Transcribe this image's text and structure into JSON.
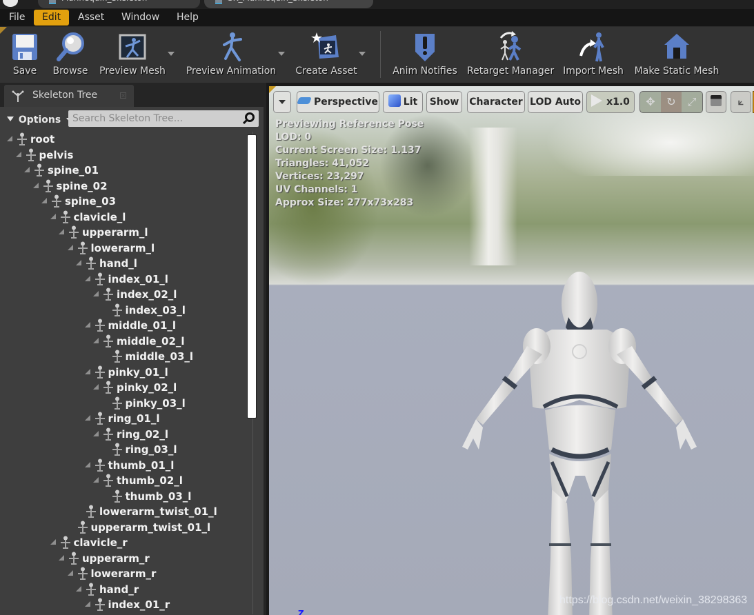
{
  "window": {
    "doc_tabs": [
      {
        "label": "Mannequin_Skeleton",
        "icon": "skeleton-asset-icon"
      },
      {
        "label": "SK_Mannequin_Skeleton",
        "icon": "skeleton-asset-icon"
      }
    ]
  },
  "menu": {
    "items": [
      {
        "label": "File",
        "active": false
      },
      {
        "label": "Edit",
        "active": true
      },
      {
        "label": "Asset",
        "active": false
      },
      {
        "label": "Window",
        "active": false
      },
      {
        "label": "Help",
        "active": false
      }
    ]
  },
  "toolbar": {
    "buttons": [
      {
        "label": "Save",
        "icon": "floppy-disk-icon",
        "dropdown": false
      },
      {
        "label": "Browse",
        "icon": "magnifier-icon",
        "dropdown": false
      },
      {
        "label": "Preview Mesh",
        "icon": "preview-mesh-icon",
        "dropdown": true
      },
      {
        "label": "Preview Animation",
        "icon": "running-figure-icon",
        "dropdown": true
      },
      {
        "label": "Create Asset",
        "icon": "create-asset-icon",
        "dropdown": true
      },
      {
        "label": "Anim Notifies",
        "icon": "exclamation-shield-icon",
        "dropdown": false
      },
      {
        "label": "Retarget Manager",
        "icon": "retarget-icon",
        "dropdown": false
      },
      {
        "label": "Import Mesh",
        "icon": "import-mesh-icon",
        "dropdown": false
      },
      {
        "label": "Make Static Mesh",
        "icon": "house-icon",
        "dropdown": false
      }
    ]
  },
  "skeleton_panel": {
    "tab_label": "Skeleton Tree",
    "options_label": "Options",
    "search_placeholder": "Search Skeleton Tree...",
    "search_value": "",
    "bones": [
      {
        "name": "root",
        "depth": 0,
        "expandable": true
      },
      {
        "name": "pelvis",
        "depth": 1,
        "expandable": true
      },
      {
        "name": "spine_01",
        "depth": 2,
        "expandable": true
      },
      {
        "name": "spine_02",
        "depth": 3,
        "expandable": true
      },
      {
        "name": "spine_03",
        "depth": 4,
        "expandable": true
      },
      {
        "name": "clavicle_l",
        "depth": 5,
        "expandable": true
      },
      {
        "name": "upperarm_l",
        "depth": 6,
        "expandable": true
      },
      {
        "name": "lowerarm_l",
        "depth": 7,
        "expandable": true
      },
      {
        "name": "hand_l",
        "depth": 8,
        "expandable": true
      },
      {
        "name": "index_01_l",
        "depth": 9,
        "expandable": true
      },
      {
        "name": "index_02_l",
        "depth": 10,
        "expandable": true
      },
      {
        "name": "index_03_l",
        "depth": 11,
        "expandable": false
      },
      {
        "name": "middle_01_l",
        "depth": 9,
        "expandable": true
      },
      {
        "name": "middle_02_l",
        "depth": 10,
        "expandable": true
      },
      {
        "name": "middle_03_l",
        "depth": 11,
        "expandable": false
      },
      {
        "name": "pinky_01_l",
        "depth": 9,
        "expandable": true
      },
      {
        "name": "pinky_02_l",
        "depth": 10,
        "expandable": true
      },
      {
        "name": "pinky_03_l",
        "depth": 11,
        "expandable": false
      },
      {
        "name": "ring_01_l",
        "depth": 9,
        "expandable": true
      },
      {
        "name": "ring_02_l",
        "depth": 10,
        "expandable": true
      },
      {
        "name": "ring_03_l",
        "depth": 11,
        "expandable": false
      },
      {
        "name": "thumb_01_l",
        "depth": 9,
        "expandable": true
      },
      {
        "name": "thumb_02_l",
        "depth": 10,
        "expandable": true
      },
      {
        "name": "thumb_03_l",
        "depth": 11,
        "expandable": false
      },
      {
        "name": "lowerarm_twist_01_l",
        "depth": 8,
        "expandable": false
      },
      {
        "name": "upperarm_twist_01_l",
        "depth": 7,
        "expandable": false
      },
      {
        "name": "clavicle_r",
        "depth": 5,
        "expandable": true
      },
      {
        "name": "upperarm_r",
        "depth": 6,
        "expandable": true
      },
      {
        "name": "lowerarm_r",
        "depth": 7,
        "expandable": true
      },
      {
        "name": "hand_r",
        "depth": 8,
        "expandable": true
      },
      {
        "name": "index_01_r",
        "depth": 9,
        "expandable": true
      }
    ]
  },
  "viewport": {
    "toolbar": {
      "options_menu": "",
      "perspective": "Perspective",
      "lit": "Lit",
      "show": "Show",
      "character": "Character",
      "lod": "LOD Auto",
      "play_speed": "x1.0"
    },
    "info_lines": [
      "Previewing Reference Pose",
      "LOD: 0",
      "Current Screen Size: 1.137",
      "Triangles: 41,052",
      "Vertices: 23,297",
      "UV Channels: 1",
      "Approx Size: 277x73x283"
    ],
    "axis_label": "Z",
    "watermark": "https://blog.csdn.net/weixin_38298363"
  },
  "colors": {
    "accent": "#e2a00e",
    "panel_bg": "#3e3e3e",
    "toolbar_bg": "#333333",
    "icon_blue": "#5b7fc7"
  }
}
